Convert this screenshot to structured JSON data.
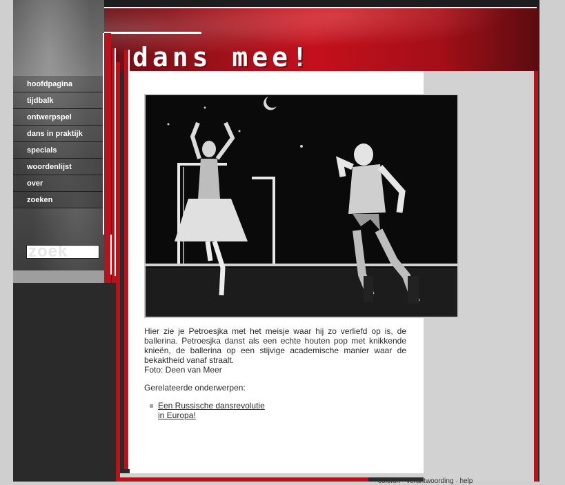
{
  "site": {
    "logo_text": "dans mee!"
  },
  "nav": {
    "items": [
      {
        "label": "hoofdpagina"
      },
      {
        "label": "tijdbalk"
      },
      {
        "label": "ontwerpspel"
      },
      {
        "label": "dans in praktijk"
      },
      {
        "label": "specials"
      },
      {
        "label": "woordenlijst"
      },
      {
        "label": "over"
      },
      {
        "label": "zoeken"
      }
    ]
  },
  "search": {
    "label": "zoek"
  },
  "main": {
    "photo_icon": "ballet-photo-petroesjka",
    "caption": "Hier zie je Petroesjka met het meisje waar hij zo verliefd op is, de ballerina. Petroesjka danst als een echte houten pop met knikkende knieën, de ballerina op een stijvige academische manier waar de bekaktheid vanaf straalt.",
    "credit": "Foto: Deen van Meer",
    "related_heading": "Gerelateerde onderwerpen:",
    "related": [
      {
        "label": "Een Russische dansrevolutie in Europa!"
      }
    ]
  },
  "footer": {
    "links": [
      "colofon",
      "verantwoording",
      "help"
    ],
    "separator": "·"
  },
  "colors": {
    "accent_red": "#b5141e",
    "sidebar_dark": "#2a2a2a",
    "page_grey": "#cfcfcf"
  }
}
